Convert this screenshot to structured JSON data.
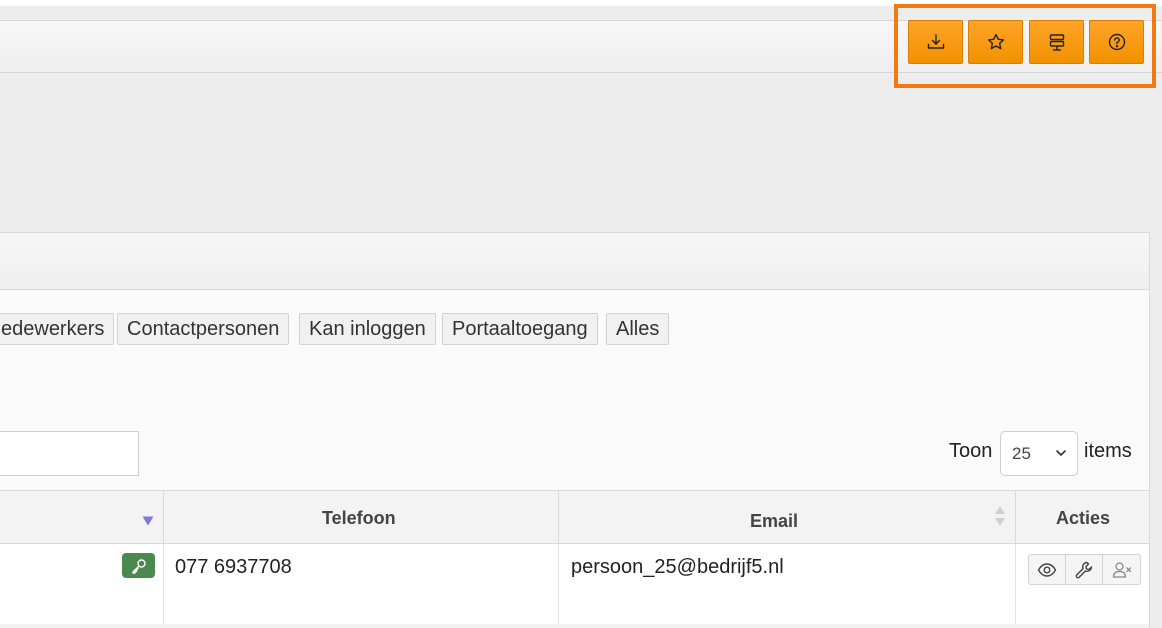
{
  "toolbar": {
    "buttons": [
      {
        "icon": "download-icon",
        "label": ""
      },
      {
        "icon": "star-icon",
        "label": ""
      },
      {
        "icon": "signpost-icon",
        "label": ""
      },
      {
        "icon": "help-icon",
        "label": ""
      }
    ],
    "accent": "#f29200",
    "highlight": "#f27a12"
  },
  "filters": {
    "items": [
      "edewerkers",
      "Contactpersonen",
      "Kan inloggen",
      "Portaaltoegang",
      "Alles"
    ]
  },
  "pager": {
    "show_label": "Toon",
    "page_size": "25",
    "items_label": "items"
  },
  "table": {
    "columns": [
      {
        "label": "",
        "sort": "desc-active"
      },
      {
        "label": "Telefoon",
        "sort": "none"
      },
      {
        "label": "Email",
        "sort": "sortable"
      },
      {
        "label": "Acties",
        "sort": "none"
      }
    ],
    "rows": [
      {
        "login_badge": "key-icon",
        "telefoon": "077 6937708",
        "email": "persoon_25@bedrijf5.nl",
        "actions": [
          "view-icon",
          "edit-icon",
          "remove-user-icon"
        ]
      }
    ]
  },
  "colors": {
    "login_badge": "#4b8a4e",
    "sort_active": "#7a7adf"
  }
}
